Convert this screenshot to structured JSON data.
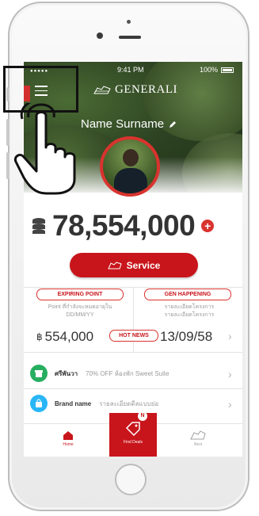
{
  "status_bar": {
    "time": "9:41 PM",
    "battery": "100%"
  },
  "brand": {
    "name": "GENERALI"
  },
  "profile": {
    "name": "Name Surname"
  },
  "points": {
    "total": "78,554,000"
  },
  "service_button": {
    "label": "Service"
  },
  "expiring": {
    "pill": "EXPIRING POINT",
    "desc_line1": "Point ที่กำลังจะหมดอายุใน",
    "desc_line2": "DD/MM/YY",
    "value": "554,000"
  },
  "gen_happening": {
    "pill": "GEN HAPPENING",
    "desc_line1": "รายละเอียดโครงการ",
    "desc_line2": "รายละเอียดโครงการ",
    "date": "13/09/58"
  },
  "hot_news": {
    "pill": "HOT NEWS"
  },
  "list": [
    {
      "title": "ศรีพันวา",
      "desc": "70% OFF ห้องพัก Sweet Suite",
      "color": "#27ae60"
    },
    {
      "title": "Brand name",
      "desc": "รายละเอียดดีลแบบย่อ",
      "color": "#29b6f6"
    }
  ],
  "tabbar": {
    "home": "Home",
    "promo": "Find Deals",
    "more": "Next",
    "badge": "N"
  },
  "colors": {
    "accent": "#c8151b",
    "ring": "#d9332e"
  }
}
